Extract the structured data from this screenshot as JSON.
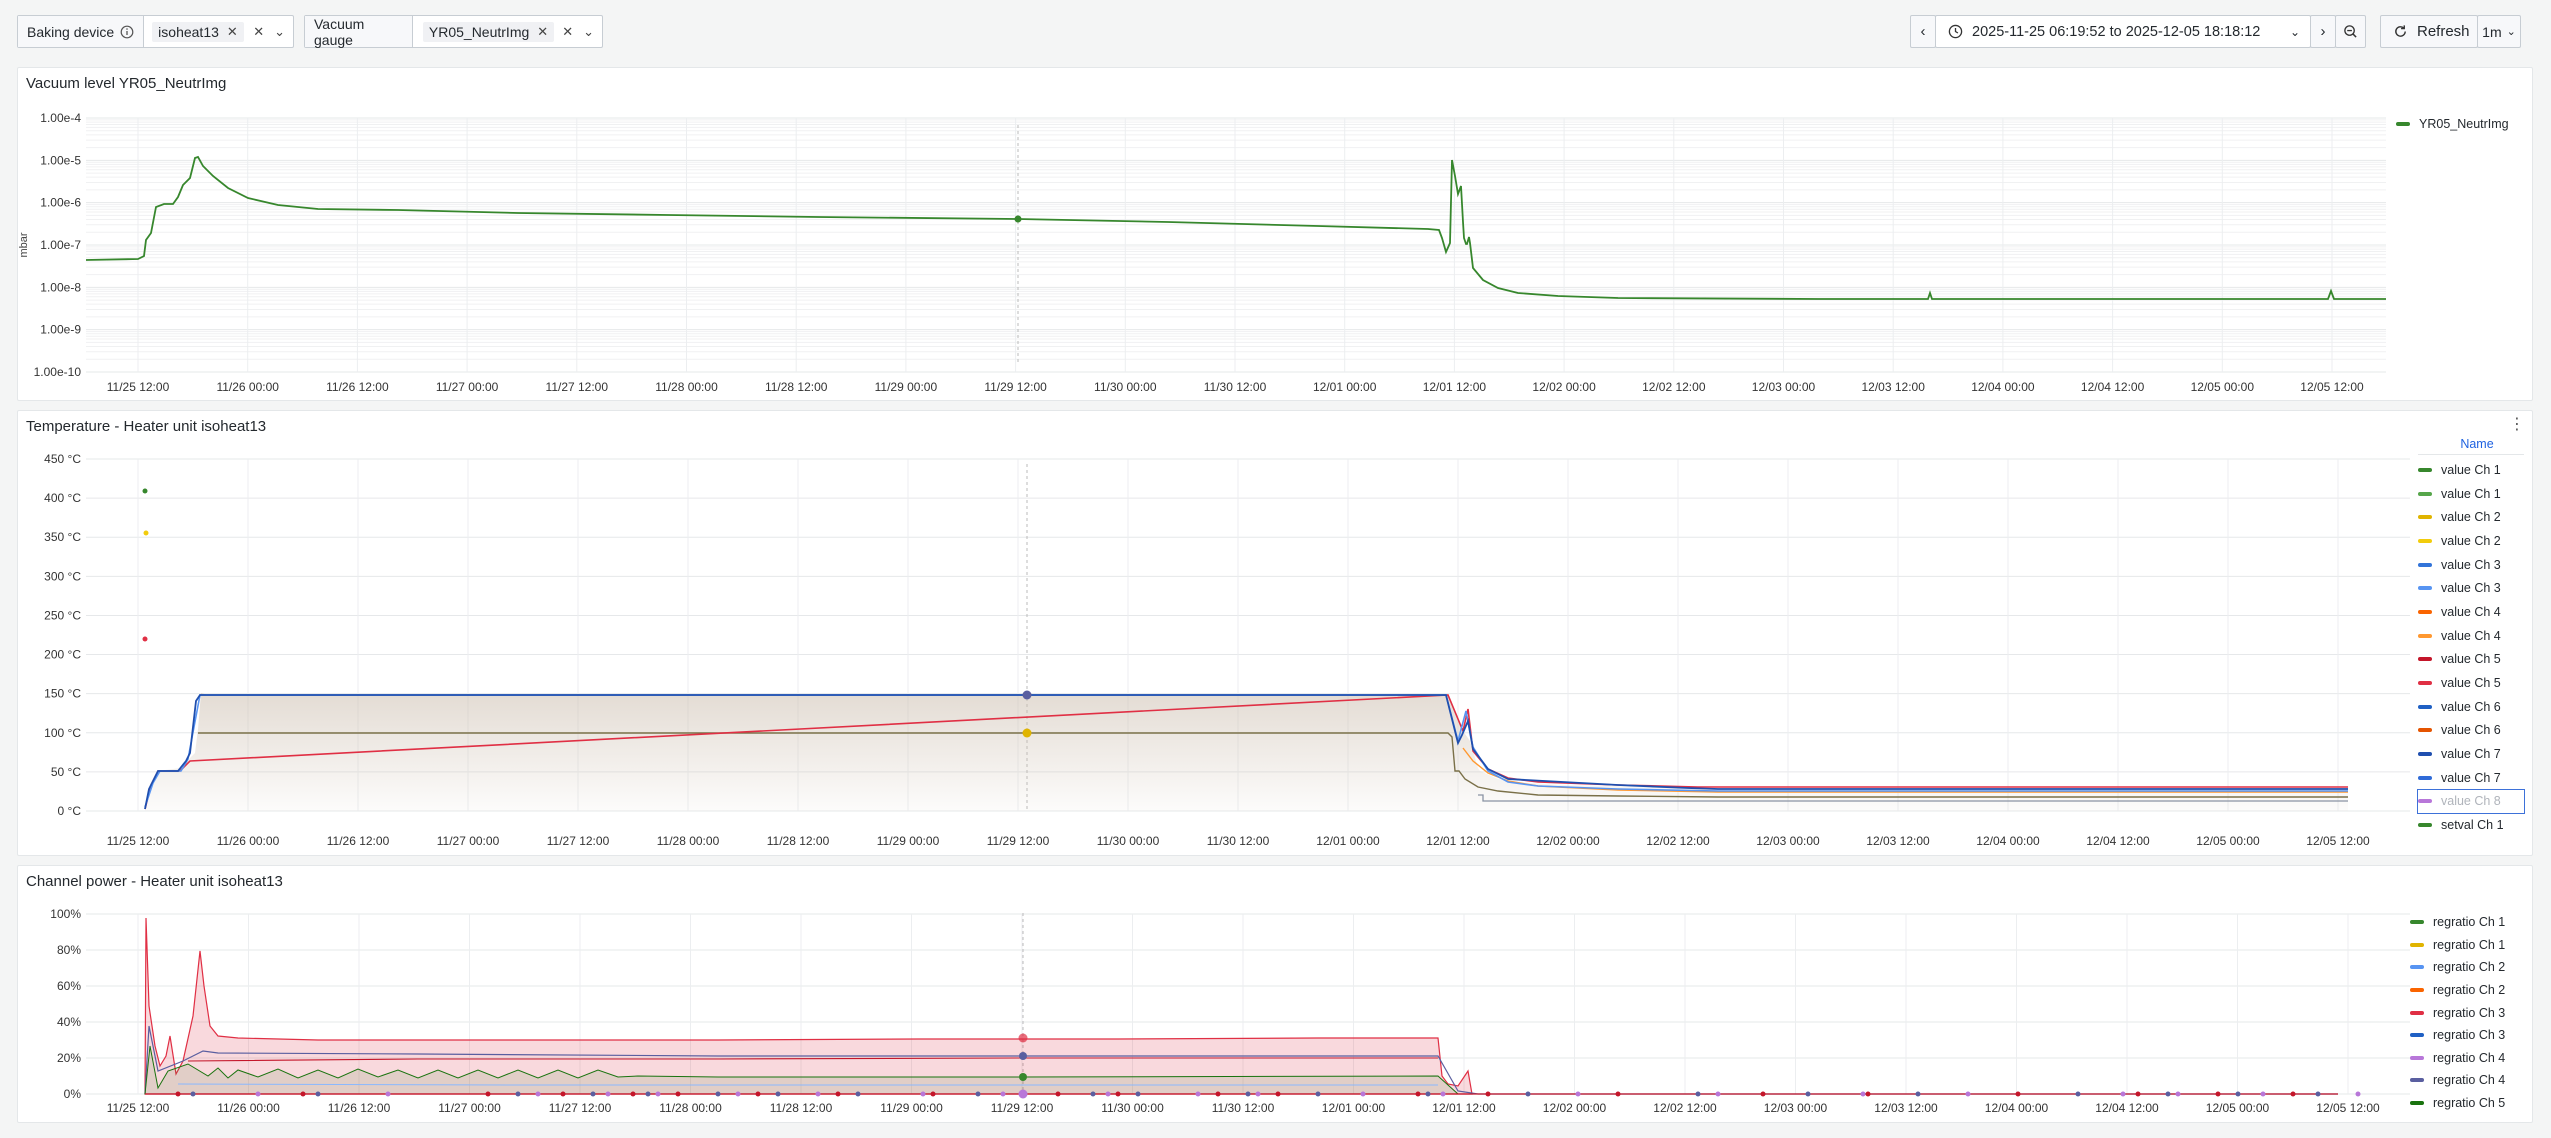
{
  "variables": {
    "baking": {
      "label": "Baking device",
      "value": "isoheat13"
    },
    "vacuum": {
      "label": "Vacuum gauge",
      "value": "YR05_NeutrImg"
    }
  },
  "timepicker": {
    "range": "2025-11-25 06:19:52 to 2025-12-05 18:18:12",
    "refresh_label": "Refresh",
    "interval": "1m"
  },
  "icons": {
    "info": "info-icon",
    "clock": "clock-icon",
    "refresh": "refresh-icon",
    "zoom_out": "zoom-out-icon",
    "prev": "chevron-left-icon",
    "next": "chevron-right-icon",
    "dropdown": "chevron-down-icon",
    "clear": "close-icon",
    "menu": "kebab-menu-icon"
  },
  "panels": {
    "vacuum": {
      "title": "Vacuum level YR05_NeutrImg",
      "unit": "mbar",
      "y_ticks": [
        "1.00e-4",
        "1.00e-5",
        "1.00e-6",
        "1.00e-7",
        "1.00e-8",
        "1.00e-9",
        "1.00e-10"
      ],
      "x_ticks": [
        "11/25 12:00",
        "11/26 00:00",
        "11/26 12:00",
        "11/27 00:00",
        "11/27 12:00",
        "11/28 00:00",
        "11/28 12:00",
        "11/29 00:00",
        "11/29 12:00",
        "11/30 00:00",
        "11/30 12:00",
        "12/01 00:00",
        "12/01 12:00",
        "12/02 00:00",
        "12/02 12:00",
        "12/03 00:00",
        "12/03 12:00",
        "12/04 00:00",
        "12/04 12:00",
        "12/05 00:00",
        "12/05 12:00"
      ],
      "legend": [
        {
          "name": "YR05_NeutrImg",
          "color": "#37872d"
        }
      ]
    },
    "temperature": {
      "title": "Temperature - Heater unit isoheat13",
      "y_ticks": [
        "450 °C",
        "400 °C",
        "350 °C",
        "300 °C",
        "250 °C",
        "200 °C",
        "150 °C",
        "100 °C",
        "50 °C",
        "0 °C"
      ],
      "x_ticks": [
        "11/25 12:00",
        "11/26 00:00",
        "11/26 12:00",
        "11/27 00:00",
        "11/27 12:00",
        "11/28 00:00",
        "11/28 12:00",
        "11/29 00:00",
        "11/29 12:00",
        "11/30 00:00",
        "11/30 12:00",
        "12/01 00:00",
        "12/01 12:00",
        "12/02 00:00",
        "12/02 12:00",
        "12/03 00:00",
        "12/03 12:00",
        "12/04 00:00",
        "12/04 12:00",
        "12/05 00:00",
        "12/05 12:00"
      ],
      "legend_header": "Name",
      "legend": [
        {
          "name": "value Ch 1",
          "color": "#37872d"
        },
        {
          "name": "value Ch 1",
          "color": "#56a64b"
        },
        {
          "name": "value Ch 2",
          "color": "#e0b400"
        },
        {
          "name": "value Ch 2",
          "color": "#f2cc0c"
        },
        {
          "name": "value Ch 3",
          "color": "#3274d9"
        },
        {
          "name": "value Ch 3",
          "color": "#5794f2"
        },
        {
          "name": "value Ch 4",
          "color": "#fa6400"
        },
        {
          "name": "value Ch 4",
          "color": "#ff9830"
        },
        {
          "name": "value Ch 5",
          "color": "#c4162a"
        },
        {
          "name": "value Ch 5",
          "color": "#e02f44"
        },
        {
          "name": "value Ch 6",
          "color": "#1f60c4"
        },
        {
          "name": "value Ch 6",
          "color": "#e55400"
        },
        {
          "name": "value Ch 7",
          "color": "#1f4faf"
        },
        {
          "name": "value Ch 7",
          "color": "#2f6bd8"
        },
        {
          "name": "value Ch 8",
          "color": "#b877d9"
        },
        {
          "name": "setval Ch 1",
          "color": "#37872d"
        }
      ]
    },
    "power": {
      "title": "Channel power - Heater unit isoheat13",
      "y_ticks": [
        "100%",
        "80%",
        "60%",
        "40%",
        "20%",
        "0%"
      ],
      "x_ticks": [
        "11/25 12:00",
        "11/26 00:00",
        "11/26 12:00",
        "11/27 00:00",
        "11/27 12:00",
        "11/28 00:00",
        "11/28 12:00",
        "11/29 00:00",
        "11/29 12:00",
        "11/30 00:00",
        "11/30 12:00",
        "12/01 00:00",
        "12/01 12:00",
        "12/02 00:00",
        "12/02 12:00",
        "12/03 00:00",
        "12/03 12:00",
        "12/04 00:00",
        "12/04 12:00",
        "12/05 00:00",
        "12/05 12:00"
      ],
      "legend": [
        {
          "name": "regratio Ch 1",
          "color": "#37872d"
        },
        {
          "name": "regratio Ch 1",
          "color": "#e0b400"
        },
        {
          "name": "regratio Ch 2",
          "color": "#5794f2"
        },
        {
          "name": "regratio Ch 2",
          "color": "#fa6400"
        },
        {
          "name": "regratio Ch 3",
          "color": "#e02f44"
        },
        {
          "name": "regratio Ch 3",
          "color": "#1f60c4"
        },
        {
          "name": "regratio Ch 4",
          "color": "#b877d9"
        },
        {
          "name": "regratio Ch 4",
          "color": "#5a5fa0"
        },
        {
          "name": "regratio Ch 5",
          "color": "#19730e"
        }
      ]
    }
  }
}
